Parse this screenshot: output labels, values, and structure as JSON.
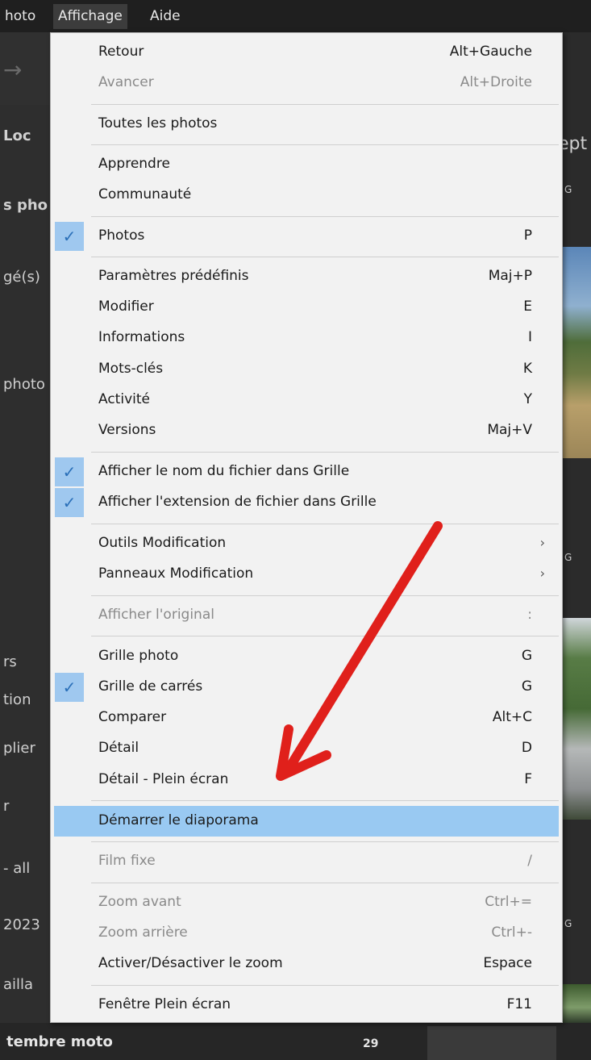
{
  "menubar": {
    "items": [
      "hoto",
      "Affichage",
      "Aide"
    ]
  },
  "background": {
    "left_texts": [
      "Loc",
      "s pho",
      "gé(s)",
      "photo",
      "rs",
      "tion",
      "plier",
      "r",
      "- all",
      "2023",
      "ailla"
    ],
    "right_texts": [
      "ept",
      "G",
      "G",
      "G"
    ],
    "bottom_label": "tembre moto",
    "bottom_count": "29"
  },
  "menu": {
    "items": [
      {
        "label": "Retour",
        "shortcut": "Alt+Gauche",
        "disabled": false
      },
      {
        "label": "Avancer",
        "shortcut": "Alt+Droite",
        "disabled": true
      },
      {
        "label": "Toutes les photos",
        "shortcut": ""
      },
      {
        "label": "Apprendre",
        "shortcut": ""
      },
      {
        "label": "Communauté",
        "shortcut": ""
      },
      {
        "label": "Photos",
        "shortcut": "P",
        "checked": true
      },
      {
        "label": "Paramètres prédéfinis",
        "shortcut": "Maj+P"
      },
      {
        "label": "Modifier",
        "shortcut": "E"
      },
      {
        "label": "Informations",
        "shortcut": "I"
      },
      {
        "label": "Mots-clés",
        "shortcut": "K"
      },
      {
        "label": "Activité",
        "shortcut": "Y"
      },
      {
        "label": "Versions",
        "shortcut": "Maj+V"
      },
      {
        "label": "Afficher le nom du fichier dans Grille",
        "shortcut": "",
        "checked": true
      },
      {
        "label": "Afficher l'extension de fichier dans Grille",
        "shortcut": "",
        "checked": true
      },
      {
        "label": "Outils Modification",
        "shortcut": "",
        "submenu": true
      },
      {
        "label": "Panneaux Modification",
        "shortcut": "",
        "submenu": true
      },
      {
        "label": "Afficher l'original",
        "shortcut": ":",
        "disabled": true
      },
      {
        "label": "Grille photo",
        "shortcut": "G"
      },
      {
        "label": "Grille de carrés",
        "shortcut": "G",
        "checked": true
      },
      {
        "label": "Comparer",
        "shortcut": "Alt+C"
      },
      {
        "label": "Détail",
        "shortcut": "D"
      },
      {
        "label": "Détail - Plein écran",
        "shortcut": "F"
      },
      {
        "label": "Démarrer le diaporama",
        "shortcut": "",
        "highlighted": true
      },
      {
        "label": "Film fixe",
        "shortcut": "/",
        "disabled": true
      },
      {
        "label": "Zoom avant",
        "shortcut": "Ctrl+=",
        "disabled": true
      },
      {
        "label": "Zoom arrière",
        "shortcut": "Ctrl+-",
        "disabled": true
      },
      {
        "label": "Activer/Désactiver le zoom",
        "shortcut": "Espace"
      },
      {
        "label": "Fenêtre Plein écran",
        "shortcut": "F11"
      }
    ],
    "check_glyph": "✓",
    "submenu_glyph": "›"
  },
  "annotation": {
    "color": "#e0201b",
    "icon": "red-arrow-icon"
  }
}
